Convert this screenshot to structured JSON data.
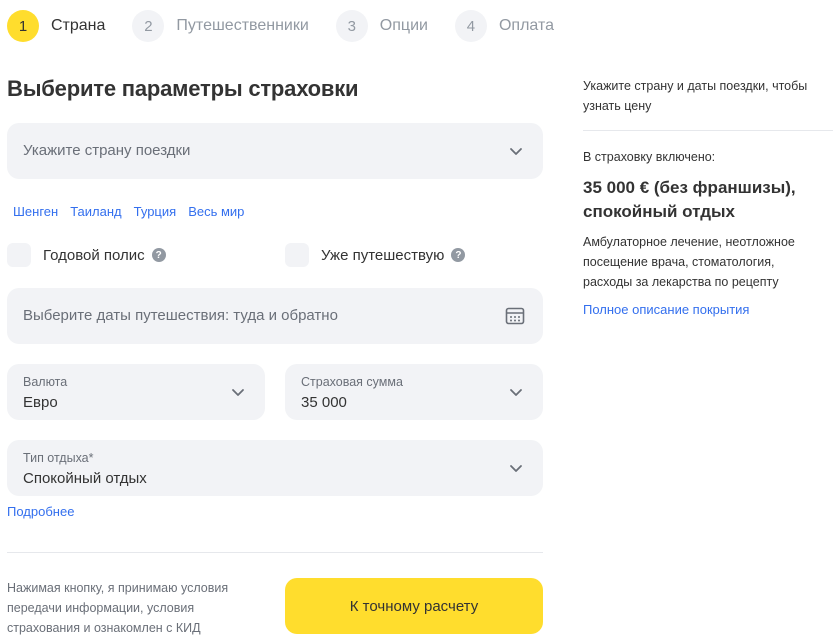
{
  "steps": [
    {
      "num": "1",
      "label": "Страна"
    },
    {
      "num": "2",
      "label": "Путешественники"
    },
    {
      "num": "3",
      "label": "Опции"
    },
    {
      "num": "4",
      "label": "Оплата"
    }
  ],
  "form": {
    "title": "Выберите параметры страховки",
    "country_placeholder": "Укажите страну поездки",
    "country_links": [
      "Шенген",
      "Таиланд",
      "Турция",
      "Весь мир"
    ],
    "annual_policy_label": "Годовой полис",
    "already_traveling_label": "Уже путешествую",
    "help_glyph": "?",
    "dates_placeholder": "Выберите даты путешествия: туда и обратно",
    "currency": {
      "label": "Валюта",
      "value": "Евро"
    },
    "sum": {
      "label": "Страховая сумма",
      "value": "35 000"
    },
    "rest_type": {
      "label": "Тип отдыха*",
      "value": "Спокойный отдых"
    },
    "more_link": "Подробнее",
    "consent_text": "Нажимая кнопку, я принимаю условия передачи информации, условия страхования и ознакомлен с КИД",
    "submit_label": "К точному расчету"
  },
  "sidebar": {
    "hint": "Укажите страну и даты поездки, чтобы узнать цену",
    "included_label": "В страховку включено:",
    "coverage_title": "35 000 € (без франшизы), спокойный отдых",
    "coverage_desc": "Амбулаторное лечение, неотложное посещение врача, стоматология, расходы за лекарства по рецепту",
    "full_desc_link": "Полное описание покрытия"
  },
  "colors": {
    "accent": "#ffdd2d",
    "link": "#336fee",
    "field_bg": "#f2f3f6"
  },
  "icons": {
    "dropdown": "chevron-down-icon",
    "calendar": "calendar-icon",
    "help": "help-circle-icon"
  }
}
